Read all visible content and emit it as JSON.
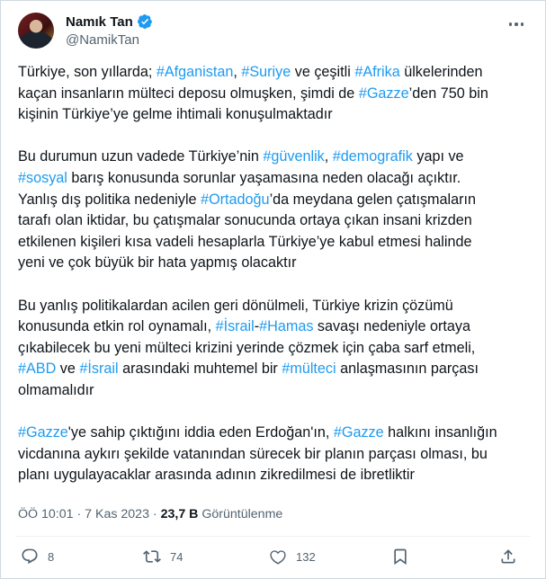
{
  "author": {
    "name": "Namık Tan",
    "handle": "@NamikTan"
  },
  "tweet": {
    "paragraphs": [
      [
        [
          {
            "t": "Türkiye, son yıllarda; "
          },
          {
            "t": "#Afganistan",
            "tag": true
          },
          {
            "t": ", "
          },
          {
            "t": "#Suriye",
            "tag": true
          },
          {
            "t": " ve çeşitli "
          },
          {
            "t": "#Afrika",
            "tag": true
          },
          {
            "t": " ülkelerinden"
          }
        ],
        [
          {
            "t": "kaçan insanların mülteci deposu olmuşken, şimdi de "
          },
          {
            "t": "#Gazze",
            "tag": true
          },
          {
            "t": "’den 750 bin"
          }
        ],
        [
          {
            "t": "kişinin Türkiye’ye gelme ihtimali konuşulmaktadır"
          }
        ]
      ],
      [
        [
          {
            "t": "Bu durumun uzun vadede Türkiye’nin "
          },
          {
            "t": "#güvenlik",
            "tag": true
          },
          {
            "t": ", "
          },
          {
            "t": "#demografik",
            "tag": true
          },
          {
            "t": " yapı ve"
          }
        ],
        [
          {
            "t": "#sosyal",
            "tag": true
          },
          {
            "t": " barış konusunda sorunlar yaşamasına neden olacağı açıktır."
          }
        ],
        [
          {
            "t": "Yanlış dış politika nedeniyle "
          },
          {
            "t": "#Ortadoğu",
            "tag": true
          },
          {
            "t": "’da meydana gelen çatışmaların"
          }
        ],
        [
          {
            "t": "tarafı olan iktidar, bu çatışmalar sonucunda ortaya çıkan insani krizden"
          }
        ],
        [
          {
            "t": "etkilenen kişileri kısa vadeli hesaplarla Türkiye’ye kabul etmesi halinde"
          }
        ],
        [
          {
            "t": "yeni ve çok büyük bir hata yapmış olacaktır"
          }
        ]
      ],
      [
        [
          {
            "t": "Bu yanlış politikalardan acilen geri dönülmeli, Türkiye krizin çözümü"
          }
        ],
        [
          {
            "t": "konusunda etkin rol oynamalı, "
          },
          {
            "t": "#İsrail",
            "tag": true
          },
          {
            "t": "-"
          },
          {
            "t": "#Hamas",
            "tag": true
          },
          {
            "t": " savaşı nedeniyle ortaya"
          }
        ],
        [
          {
            "t": "çıkabilecek bu yeni mülteci krizini yerinde çözmek için çaba sarf etmeli,"
          }
        ],
        [
          {
            "t": "#ABD",
            "tag": true
          },
          {
            "t": " ve "
          },
          {
            "t": "#İsrail",
            "tag": true
          },
          {
            "t": " arasındaki muhtemel bir "
          },
          {
            "t": "#mülteci",
            "tag": true
          },
          {
            "t": " anlaşmasının parçası"
          }
        ],
        [
          {
            "t": "olmamalıdır"
          }
        ]
      ],
      [
        [
          {
            "t": "#Gazze",
            "tag": true
          },
          {
            "t": "'ye sahip çıktığını iddia eden Erdoğan'ın, "
          },
          {
            "t": "#Gazze",
            "tag": true
          },
          {
            "t": " halkını insanlığın"
          }
        ],
        [
          {
            "t": "vicdanına aykırı şekilde vatanından sürecek bir planın parçası olması, bu"
          }
        ],
        [
          {
            "t": "planı uygulayacaklar arasında  adının zikredilmesi de ibretliktir"
          }
        ]
      ]
    ]
  },
  "meta": {
    "time": "ÖÖ 10:01",
    "date": "7 Kas 2023",
    "separator": "·",
    "views_count": "23,7 B",
    "views_label": "Görüntülenme"
  },
  "actions": {
    "replies": "8",
    "reposts": "74",
    "likes": "132"
  },
  "icons": [
    "verified-badge-icon",
    "more-icon",
    "reply-icon",
    "repost-icon",
    "like-icon",
    "share-icon"
  ],
  "colors": {
    "hashtag": "#1d9bf0",
    "verified": "#1d9bf0",
    "text": "#0f1419",
    "secondary": "#536471"
  }
}
